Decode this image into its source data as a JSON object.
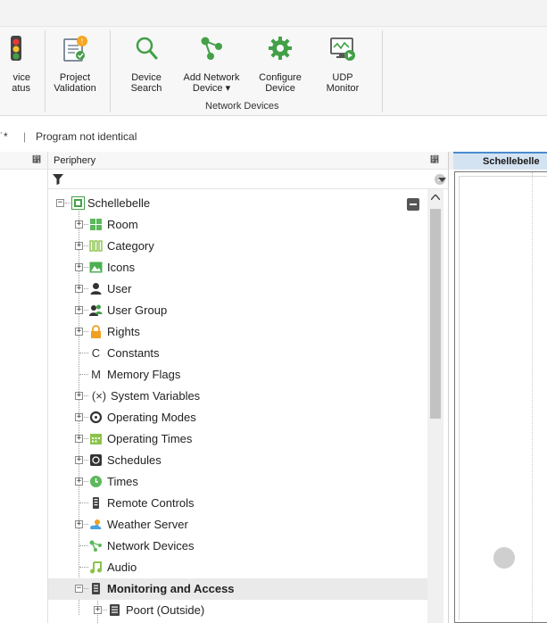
{
  "ribbon": {
    "buttons": [
      {
        "label1": "vice",
        "label2": "atus",
        "icon": "traffic-light-icon"
      },
      {
        "label1": "Project",
        "label2": "Validation",
        "icon": "project-validation-icon"
      },
      {
        "label1": "Device",
        "label2": "Search",
        "icon": "search-icon"
      },
      {
        "label1": "Add Network",
        "label2": "Device ▾",
        "icon": "network-add-icon"
      },
      {
        "label1": "Configure",
        "label2": "Device",
        "icon": "gear-icon"
      },
      {
        "label1": "UDP",
        "label2": "Monitor",
        "icon": "udp-monitor-icon"
      }
    ],
    "group_label": "Network Devices"
  },
  "statusline": {
    "fragment": "˙*",
    "separator": "|",
    "message": "Program not identical"
  },
  "periphery": {
    "title": "Periphery",
    "pin_glyph": "⵱",
    "filter_value": "",
    "clear_glyph": "✕",
    "root": "Schellebelle",
    "items": [
      {
        "label": "Room",
        "icon": "room-icon",
        "color": "#5cb85c",
        "expandable": true
      },
      {
        "label": "Category",
        "icon": "category-icon",
        "color": "#8bc34a",
        "expandable": true
      },
      {
        "label": "Icons",
        "icon": "image-icon",
        "color": "#4caf50",
        "expandable": true
      },
      {
        "label": "User",
        "icon": "user-icon",
        "color": "#333333",
        "expandable": true
      },
      {
        "label": "User Group",
        "icon": "user-group-icon",
        "color": "#333333",
        "expandable": true
      },
      {
        "label": "Rights",
        "icon": "lock-icon",
        "color": "#f0a020",
        "expandable": true
      },
      {
        "label": "Constants",
        "icon": "letter-c",
        "glyph": "C",
        "expandable": false
      },
      {
        "label": "Memory Flags",
        "icon": "letter-m",
        "glyph": "M",
        "expandable": false
      },
      {
        "label": "System Variables",
        "icon": "variable-icon",
        "glyph": "(×)",
        "expandable": true
      },
      {
        "label": "Operating Modes",
        "icon": "gear-icon",
        "color": "#333333",
        "expandable": true
      },
      {
        "label": "Operating Times",
        "icon": "calendar-icon",
        "color": "#8bc34a",
        "expandable": true
      },
      {
        "label": "Schedules",
        "icon": "schedule-icon",
        "color": "#333333",
        "expandable": true
      },
      {
        "label": "Times",
        "icon": "clock-icon",
        "color": "#5cb85c",
        "expandable": true
      },
      {
        "label": "Remote Controls",
        "icon": "remote-icon",
        "color": "#444444",
        "expandable": false
      },
      {
        "label": "Weather Server",
        "icon": "weather-icon",
        "color": "#f0a020",
        "expandable": true
      },
      {
        "label": "Network Devices",
        "icon": "network-icon",
        "color": "#5cb85c",
        "expandable": false
      },
      {
        "label": "Audio",
        "icon": "music-icon",
        "color": "#8bc34a",
        "expandable": false
      },
      {
        "label": "Monitoring and Access",
        "icon": "monitor-device-icon",
        "color": "#444444",
        "expandable": true,
        "selected": true
      },
      {
        "label": "Poort (Outside)",
        "icon": "door-device-icon",
        "color": "#444444",
        "expandable": true
      }
    ]
  },
  "editor": {
    "tab_label": "Schellebelle"
  }
}
